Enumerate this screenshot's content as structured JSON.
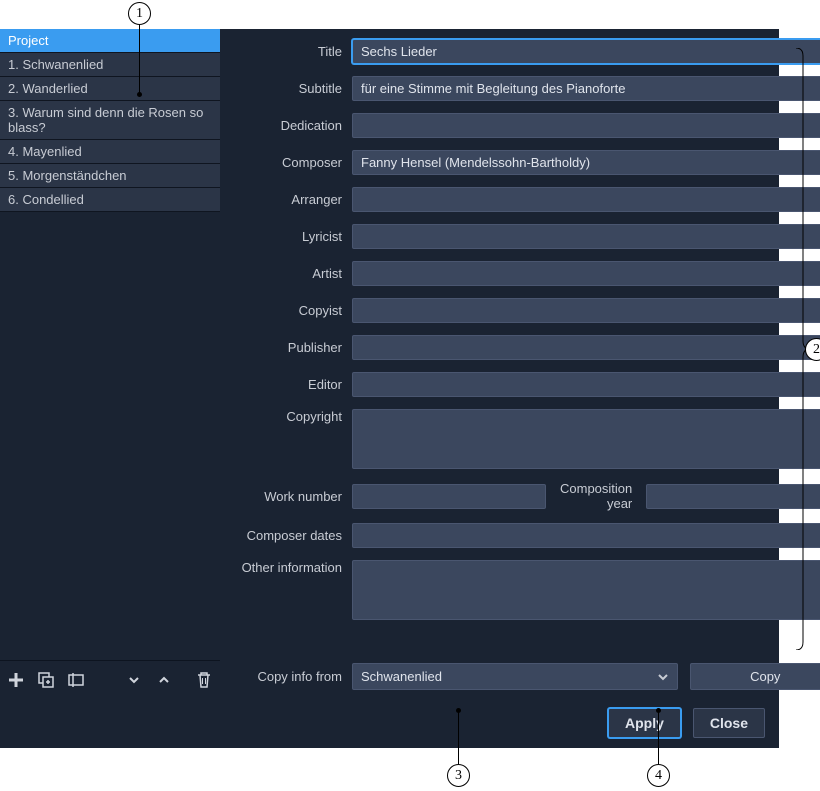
{
  "sidebar": {
    "items": [
      {
        "label": "Project",
        "selected": true
      },
      {
        "label": "1. Schwanenlied",
        "selected": false
      },
      {
        "label": "2. Wanderlied",
        "selected": false
      },
      {
        "label": "3. Warum sind denn die Rosen so blass?",
        "selected": false
      },
      {
        "label": "4. Mayenlied",
        "selected": false
      },
      {
        "label": "5. Morgenständchen",
        "selected": false
      },
      {
        "label": "6. Condellied",
        "selected": false
      }
    ]
  },
  "form": {
    "title_label": "Title",
    "title_value": "Sechs Lieder",
    "subtitle_label": "Subtitle",
    "subtitle_value": "für eine Stimme mit Begleitung des Pianoforte",
    "dedication_label": "Dedication",
    "dedication_value": "",
    "composer_label": "Composer",
    "composer_value": "Fanny Hensel (Mendelssohn-Bartholdy)",
    "arranger_label": "Arranger",
    "arranger_value": "",
    "lyricist_label": "Lyricist",
    "lyricist_value": "",
    "artist_label": "Artist",
    "artist_value": "",
    "copyist_label": "Copyist",
    "copyist_value": "",
    "publisher_label": "Publisher",
    "publisher_value": "",
    "editor_label": "Editor",
    "editor_value": "",
    "copyright_label": "Copyright",
    "copyright_value": "",
    "worknumber_label": "Work number",
    "worknumber_value": "",
    "compyear_label": "Composition year",
    "compyear_value": "",
    "compdates_label": "Composer dates",
    "compdates_value": "",
    "otherinfo_label": "Other information",
    "otherinfo_value": ""
  },
  "copy": {
    "label": "Copy info from",
    "selected": "Schwanenlied",
    "button": "Copy"
  },
  "buttons": {
    "apply": "Apply",
    "close": "Close"
  },
  "callouts": {
    "c1": "1",
    "c2": "2",
    "c3": "3",
    "c4": "4"
  }
}
